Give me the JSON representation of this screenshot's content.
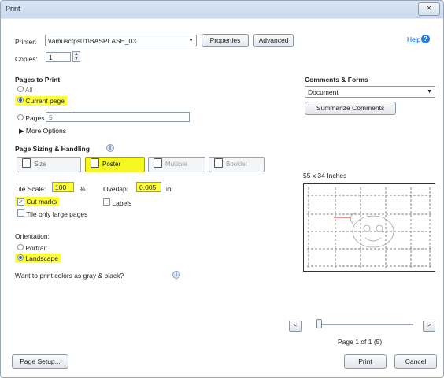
{
  "window": {
    "title": "Print",
    "close_glyph": "✕"
  },
  "printer": {
    "label": "Printer:",
    "value": "\\\\amusctps01\\BASPLASH_03",
    "properties_label": "Properties",
    "advanced_label": "Advanced",
    "help_label": "Help"
  },
  "copies": {
    "label": "Copies:",
    "value": "1"
  },
  "pages_to_print": {
    "heading": "Pages to Print",
    "all_label": "All",
    "current_page_label": "Current page",
    "pages_label": "Pages",
    "pages_value": "5",
    "more_options_label": "More Options",
    "selected": "current_page"
  },
  "page_sizing": {
    "heading": "Page Sizing & Handling",
    "buttons": [
      {
        "label": "Size",
        "state": "normal"
      },
      {
        "label": "Poster",
        "state": "active"
      },
      {
        "label": "Multiple",
        "state": "disabled"
      },
      {
        "label": "Booklet",
        "state": "disabled"
      }
    ],
    "tile_scale_label": "Tile Scale:",
    "tile_scale_value": "100",
    "tile_scale_unit": "%",
    "overlap_label": "Overlap:",
    "overlap_value": "0.005",
    "overlap_unit": "in",
    "cut_marks_label": "Cut marks",
    "cut_marks_checked": true,
    "labels_label": "Labels",
    "labels_checked": false,
    "tile_large_label": "Tile only large pages",
    "tile_large_checked": false
  },
  "orientation": {
    "heading": "Orientation:",
    "portrait_label": "Portrait",
    "landscape_label": "Landscape",
    "selected": "landscape"
  },
  "gray_print": {
    "label": "Want to print colors as gray & black?"
  },
  "comments_forms": {
    "heading": "Comments & Forms",
    "value": "Document",
    "summarize_label": "Summarize Comments"
  },
  "preview": {
    "size_label": "55 x 34 Inches",
    "page_indicator": "Page 1 of 1 (5)",
    "prev_glyph": "<",
    "next_glyph": ">"
  },
  "footer": {
    "page_setup_label": "Page Setup...",
    "print_label": "Print",
    "cancel_label": "Cancel"
  },
  "colors": {
    "highlight": "#ffff3a",
    "active_button": "#f4f820",
    "link": "#1a56c7"
  }
}
